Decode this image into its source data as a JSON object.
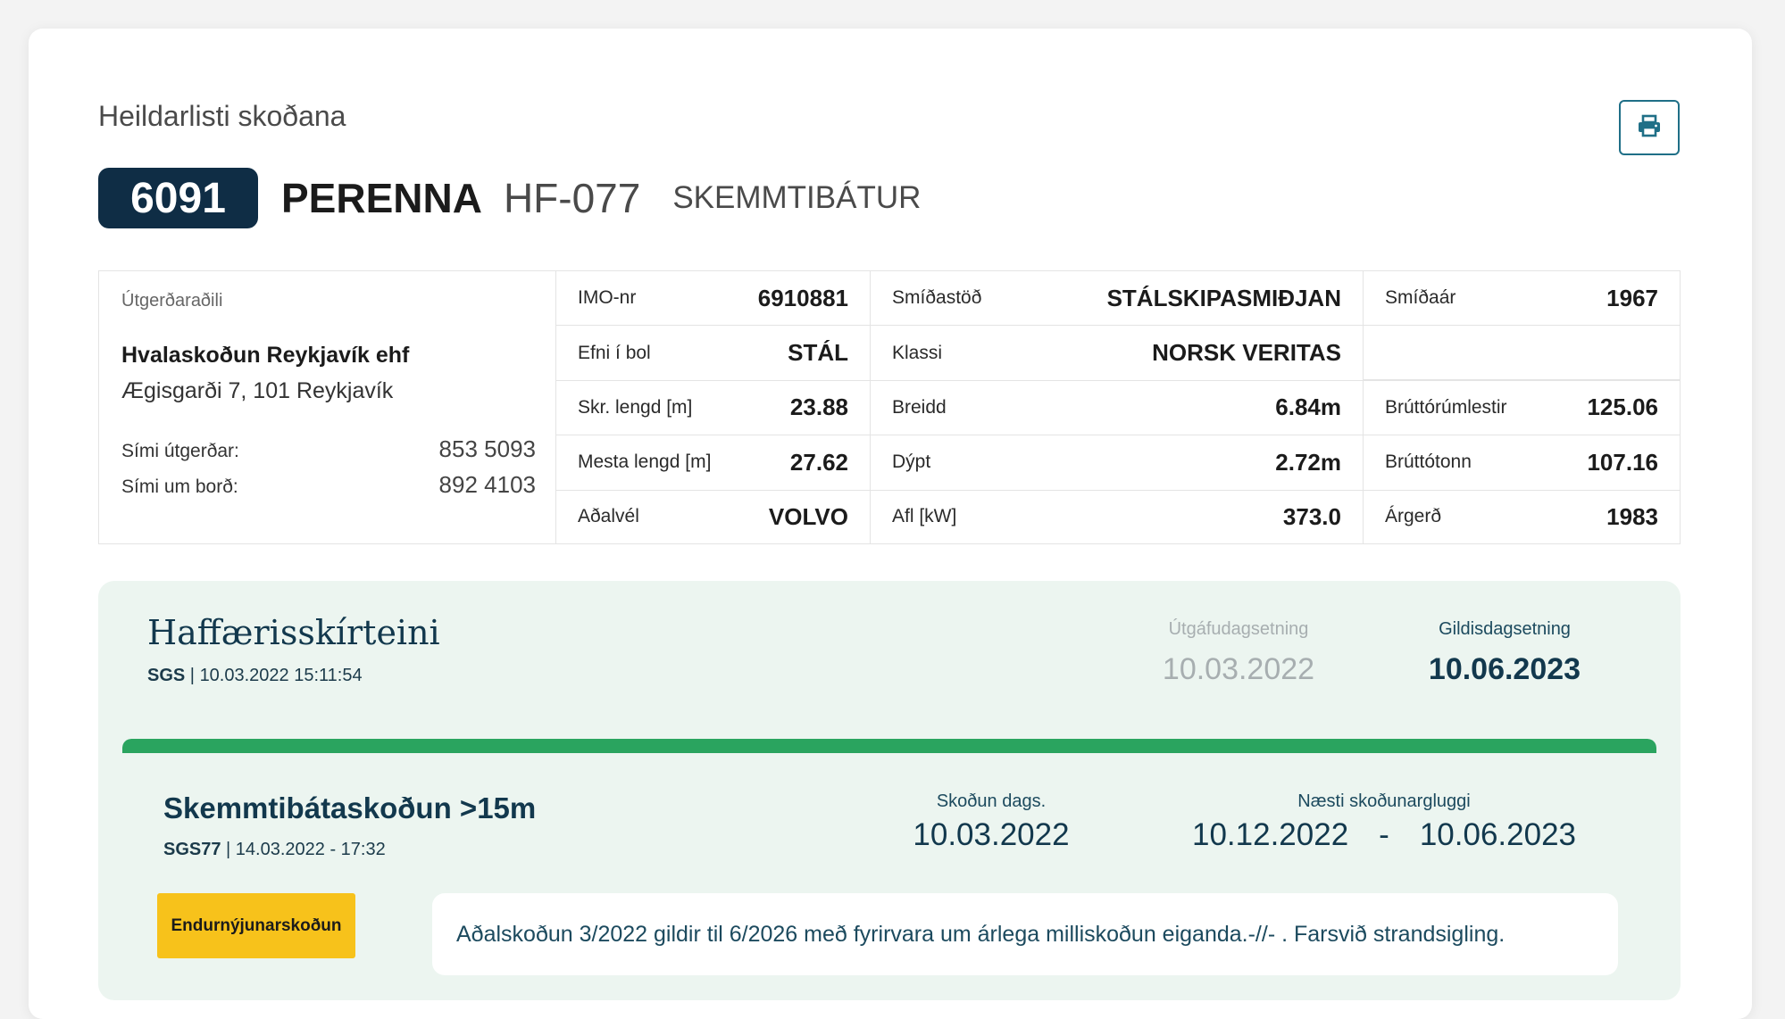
{
  "header": {
    "subtitle": "Heildarlisti skoðana",
    "print_icon": "printer-icon"
  },
  "vessel": {
    "number": "6091",
    "name": "PERENNA",
    "registration": "HF-077",
    "type": "SKEMMTIBÁTUR"
  },
  "owner": {
    "label": "Útgerðaraðili",
    "name": "Hvalaskoðun Reykjavík ehf",
    "address": "Ægisgarði 7, 101 Reykjavík",
    "phones": [
      {
        "label": "Sími útgerðar:",
        "value": "853 5093"
      },
      {
        "label": "Sími um borð:",
        "value": "892 4103"
      }
    ]
  },
  "specs": [
    [
      {
        "label": "IMO-nr",
        "value": "6910881"
      },
      {
        "label": "Smíðastöð",
        "value": "STÁLSKIPASMIÐJAN"
      },
      {
        "label": "Smíðaár",
        "value": "1967"
      }
    ],
    [
      {
        "label": "Efni í bol",
        "value": "STÁL"
      },
      {
        "label": "Klassi",
        "value": "NORSK VERITAS"
      },
      {
        "label": "",
        "value": ""
      }
    ],
    [
      {
        "label": "Skr. lengd [m]",
        "value": "23.88"
      },
      {
        "label": "Breidd",
        "value": "6.84m"
      },
      {
        "label": "Brúttórúmlestir",
        "value": "125.06"
      }
    ],
    [
      {
        "label": "Mesta lengd [m]",
        "value": "27.62"
      },
      {
        "label": "Dýpt",
        "value": "2.72m"
      },
      {
        "label": "Brúttótonn",
        "value": "107.16"
      }
    ],
    [
      {
        "label": "Aðalvél",
        "value": "VOLVO"
      },
      {
        "label": "Afl [kW]",
        "value": "373.0"
      },
      {
        "label": "Árgerð",
        "value": "1983"
      }
    ]
  ],
  "certificate": {
    "title": "Haffærisskírteini",
    "issuer": "SGS",
    "timestamp": "10.03.2022 15:11:54",
    "issue_label": "Útgáfudagsetning",
    "issue_date": "10.03.2022",
    "valid_label": "Gildisdagsetning",
    "valid_date": "10.06.2023",
    "progress": 1.0,
    "progress_color": "#2aa45f"
  },
  "inspection": {
    "title": "Skemmtibátaskoðun >15m",
    "code": "SGS77",
    "timestamp": "14.03.2022 - 17:32",
    "date_label": "Skoðun dags.",
    "date": "10.03.2022",
    "window_label": "Næsti skoðunargluggi",
    "window_start": "10.12.2022",
    "window_sep": "-",
    "window_end": "10.06.2023",
    "type_button": "Endurnýjunarskoðun",
    "remark": "Aðalskoðun 3/2022 gildir til 6/2026 með fyrirvara um árlega milliskoðun eiganda.-//- . Farsvið strandsigling."
  },
  "colors": {
    "navy": "#0f2d45",
    "accent": "#1f6f87",
    "cert_bg": "#ecf5f0",
    "yellow": "#f7c21b"
  }
}
